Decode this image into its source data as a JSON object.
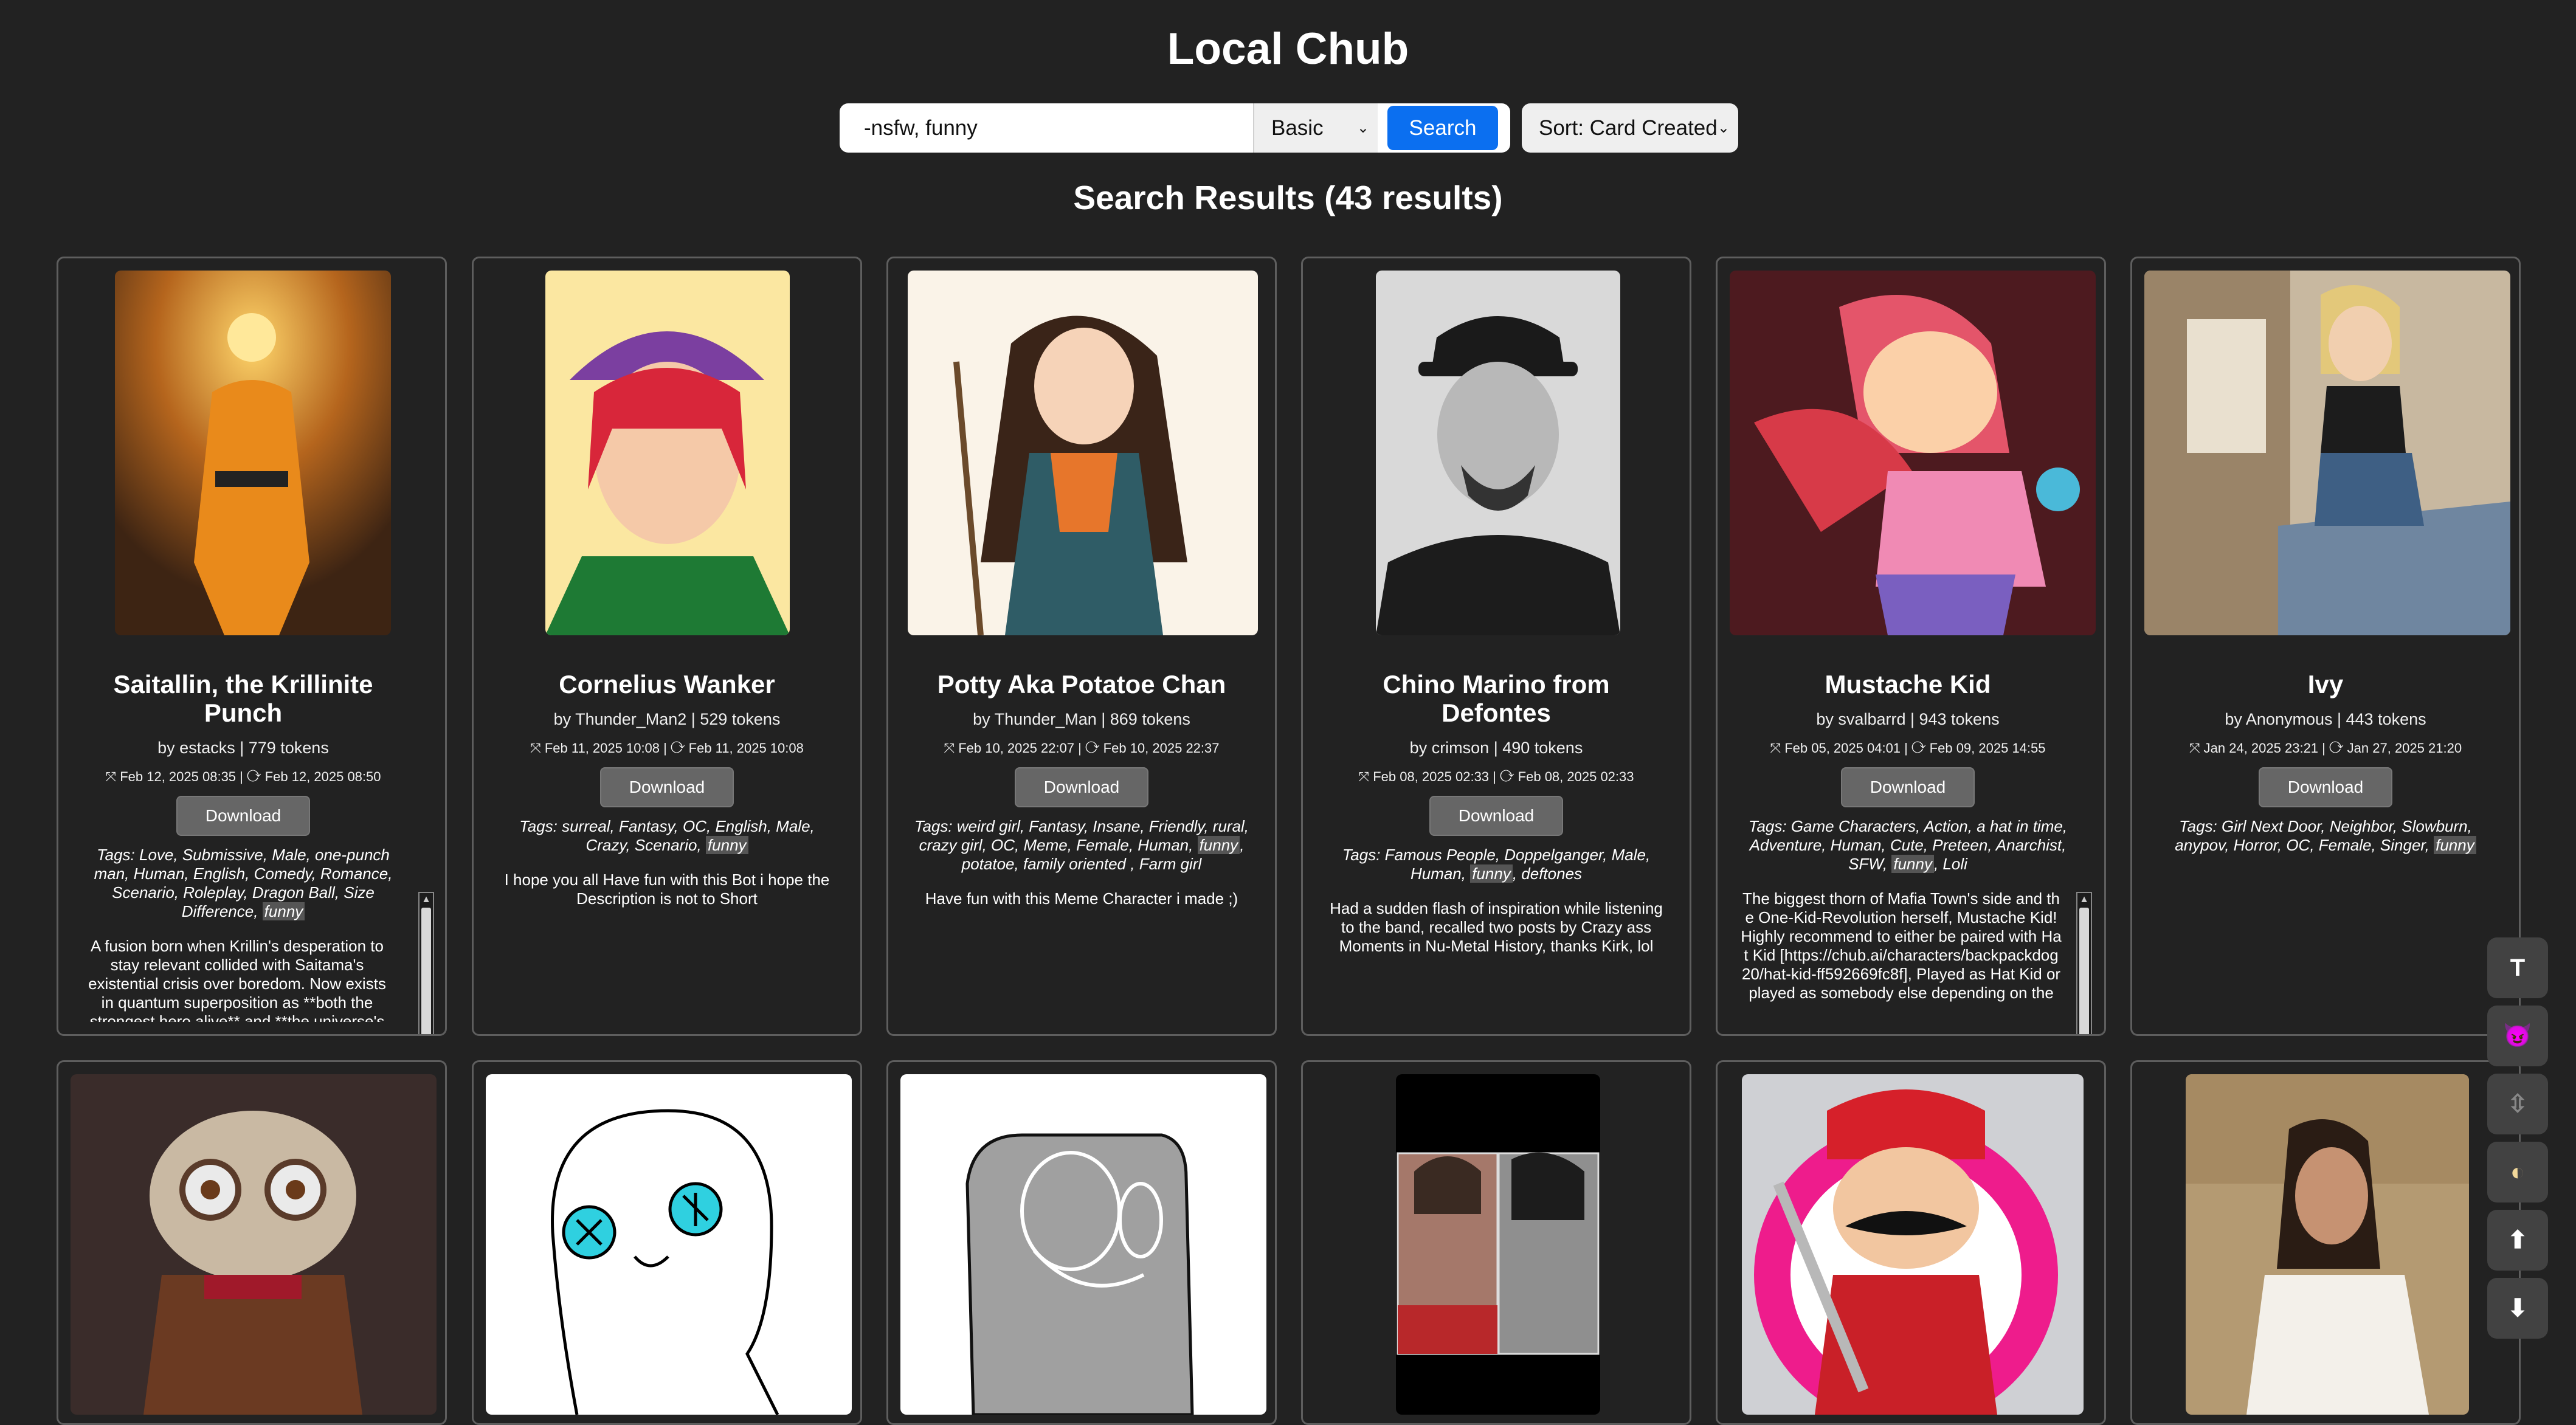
{
  "app": {
    "title": "Local Chub"
  },
  "search": {
    "value": "-nsfw, funny",
    "mode": "Basic",
    "button": "Search",
    "sort": "Sort: Card Created"
  },
  "results_heading": "Search Results (43 results)",
  "cards": [
    {
      "title": "Saitallin, the Krillinite Punch",
      "author": "by estacks | 779 tokens",
      "dates": "⤧ Feb 12, 2025 08:35 | ⟳ Feb 12, 2025 08:50",
      "download": "Download",
      "tags": "Tags: Love, Submissive, Male, one-punch man, Human, English, Comedy, Romance, Scenario, Roleplay, Dragon Ball, Size Difference,",
      "tag_highlight": "funny",
      "description": "A fusion born when Krillin's desperation to stay relevant collided with Saitama's existential crisis over boredom. Now exists in quantum superposition as **both the strongest hero alive** and **the universe's"
    },
    {
      "title": "Cornelius Wanker",
      "author": "by Thunder_Man2 | 529 tokens",
      "dates": "⤧ Feb 11, 2025 10:08 | ⟳ Feb 11, 2025 10:08",
      "download": "Download",
      "tags": "Tags: surreal, Fantasy, OC, English, Male, Crazy, Scenario,",
      "tag_highlight": "funny",
      "description": "I hope you all Have fun with this Bot i hope the Description is not to Short"
    },
    {
      "title": "Potty Aka Potatoe Chan",
      "author": "by Thunder_Man | 869 tokens",
      "dates": "⤧ Feb 10, 2025 22:07 | ⟳ Feb 10, 2025 22:37",
      "download": "Download",
      "tags": "Tags: weird girl, Fantasy, Insane, Friendly, rural, crazy girl, OC, Meme, Female, Human,",
      "tag_highlight": "funny",
      "tags_after": ", potatoe, family oriented , Farm girl",
      "description": "Have fun with this Meme Character i made ;)"
    },
    {
      "title": "Chino Marino from Defontes",
      "author": "by crimson | 490 tokens",
      "dates": "⤧ Feb 08, 2025 02:33 | ⟳ Feb 08, 2025 02:33",
      "download": "Download",
      "tags": "Tags: Famous People, Doppelganger, Male, Human,",
      "tag_highlight": "funny",
      "tags_after": ", deftones",
      "description": "Had a sudden flash of inspiration while listening to the band, recalled two posts by Crazy ass Moments in Nu-Metal History, thanks Kirk, lol"
    },
    {
      "title": "Mustache Kid",
      "author": "by svalbarrd | 943 tokens",
      "dates": "⤧ Feb 05, 2025 04:01 | ⟳ Feb 09, 2025 14:55",
      "download": "Download",
      "tags": "Tags: Game Characters, Action, a hat in time, Adventure, Human, Cute, Preteen, Anarchist, SFW,",
      "tag_highlight": "funny",
      "tags_after": ", Loli",
      "description": "The biggest thorn of Mafia Town's side and the One-Kid-Revolution herself, Mustache Kid! Highly recommend to either be paired with Hat Kid [https://chub.ai/characters/backpackdog20/hat-kid-ff592669fc8f], Played as Hat Kid or played as somebody else depending on the"
    },
    {
      "title": "Ivy",
      "author": "by Anonymous | 443 tokens",
      "dates": "⤧ Jan 24, 2025 23:21 | ⟳ Jan 27, 2025 21:20",
      "download": "Download",
      "tags": "Tags: Girl Next Door, Neighbor, Slowburn, anypov, Horror, OC, Female, Singer,",
      "tag_highlight": "funny",
      "description": ""
    }
  ],
  "side_buttons": [
    "T",
    "😈",
    "⇳",
    "◐",
    "⬆",
    "⬇"
  ],
  "colors": {
    "background": "#222222",
    "accent": "#0b6ff0",
    "card_border": "#5e5e5e"
  }
}
